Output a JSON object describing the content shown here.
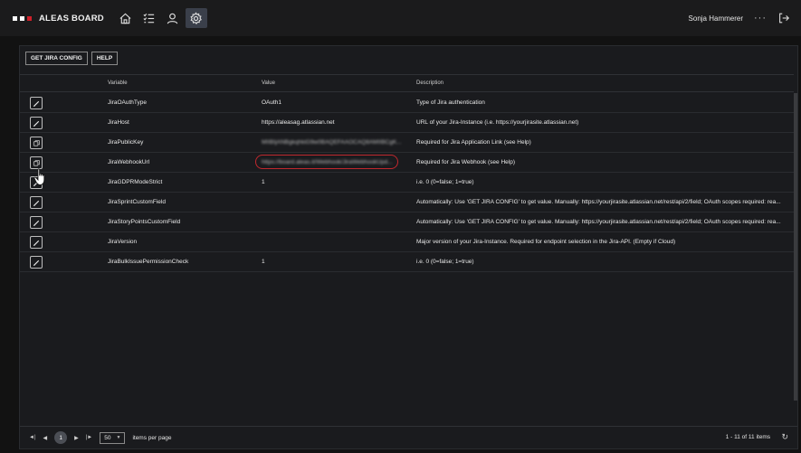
{
  "app": {
    "title": "ALEAS BOARD",
    "logo_colors": [
      "#ffffff",
      "#ffffff",
      "#d0202a"
    ]
  },
  "header": {
    "user_name": "Sonja Hammerer",
    "more_label": "···"
  },
  "toolbar": {
    "get_config_label": "GET JIRA CONFIG",
    "help_label": "HELP"
  },
  "grid": {
    "columns": [
      "Variable",
      "Value",
      "Description"
    ],
    "rows": [
      {
        "variable": "JiraOAuthType",
        "value": "OAuth1",
        "description": "Type of Jira authentication",
        "action": "edit"
      },
      {
        "variable": "JiraHost",
        "value": "https://aleasag.atlassian.net",
        "description": "URL of your Jira-Instance (i.e. https://yourjirasite.atlassian.net)",
        "action": "edit"
      },
      {
        "variable": "JiraPublicKey",
        "value": "MIIBIjANBgkqhkiG9w0BAQEFAAOCAQ8AMIIBCgK...",
        "description": "Required for Jira Application Link (see Help)",
        "action": "copy",
        "blurred": true
      },
      {
        "variable": "JiraWebhookUrl",
        "value": "https://board.aleas.it/Webhook/JiraWebhookUpd...",
        "description": "Required for Jira Webhook (see Help)",
        "action": "copy",
        "blurred": true,
        "highlighted": true
      },
      {
        "variable": "JiraGDPRModeStrict",
        "value": "1",
        "description": "i.e. 0 (0=false; 1=true)",
        "action": "edit"
      },
      {
        "variable": "JiraSprintCustomField",
        "value": "",
        "description": "Automatically: Use 'GET JIRA CONFIG' to get value. Manually: https://yourjirasite.atlassian.net/rest/api/2/field; OAuth scopes required: rea...",
        "action": "edit"
      },
      {
        "variable": "JiraStoryPointsCustomField",
        "value": "",
        "description": "Automatically: Use 'GET JIRA CONFIG' to get value. Manually: https://yourjirasite.atlassian.net/rest/api/2/field; OAuth scopes required: rea...",
        "action": "edit"
      },
      {
        "variable": "JiraVersion",
        "value": "",
        "description": "Major version of your Jira-Instance. Required for endpoint selection in the Jira-API. (Empty if Cloud)",
        "action": "edit"
      },
      {
        "variable": "JiraBulkIssuePermissionCheck",
        "value": "1",
        "description": "i.e. 0 (0=false; 1=true)",
        "action": "edit"
      }
    ]
  },
  "footer": {
    "current_page": "1",
    "page_size": "50",
    "page_size_label": "items per page",
    "count_label": "1 - 11 of 11 items"
  },
  "icons": {
    "nav": [
      "home-icon",
      "checklist-icon",
      "user-icon",
      "settings-icon"
    ],
    "logout": "logout-icon"
  }
}
